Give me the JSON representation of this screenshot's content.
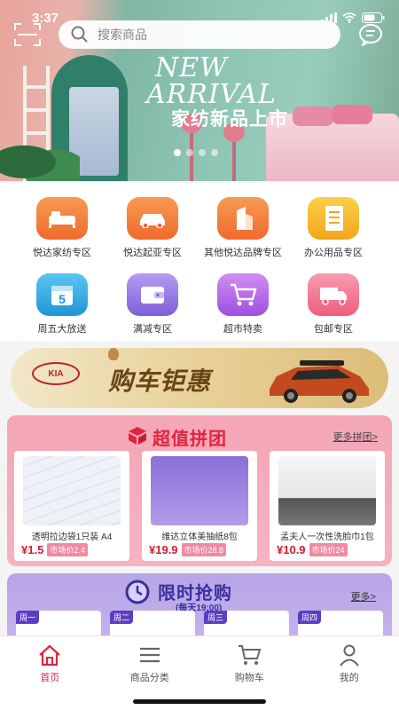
{
  "status": {
    "time": "3:37"
  },
  "search": {
    "placeholder": "搜索商品"
  },
  "banner": {
    "headline_line1": "NEW",
    "headline_line2": "ARRIVAL",
    "subtitle": "家纺新品上市",
    "active_slide": 1,
    "slide_count": 4
  },
  "categories": [
    {
      "label": "悦达家纺专区",
      "icon": "bed-icon",
      "color": "#f07a3a"
    },
    {
      "label": "悦达起亚专区",
      "icon": "car-icon",
      "color": "#f07a3a"
    },
    {
      "label": "其他悦达品牌专区",
      "icon": "building-icon",
      "color": "#f07a3a"
    },
    {
      "label": "办公用品专区",
      "icon": "notebook-icon",
      "color": "#f6b21e"
    },
    {
      "label": "周五大放送",
      "icon": "calendar-icon",
      "color": "#2aa8e8"
    },
    {
      "label": "满减专区",
      "icon": "wallet-icon",
      "color": "#8e72e0"
    },
    {
      "label": "超市特卖",
      "icon": "shopping-cart-icon",
      "color": "#a45be0"
    },
    {
      "label": "包邮专区",
      "icon": "truck-icon",
      "color": "#f06d86"
    }
  ],
  "car_promo": {
    "brand": "KIA",
    "headline": "购车钜惠"
  },
  "group_buy": {
    "title": "超值拼团",
    "more": "更多拼团>",
    "items": [
      {
        "name": "透明拉边袋1只装 A4",
        "price": "¥1.5",
        "market": "市场价2.4"
      },
      {
        "name": "维达立体美抽纸8包",
        "price": "¥19.9",
        "market": "市场价28.8"
      },
      {
        "name": "孟夫人一次性洗脸巾1包",
        "price": "¥10.9",
        "market": "市场价24"
      }
    ]
  },
  "flash_sale": {
    "title": "限时抢购",
    "subtitle": "(每天19:00)",
    "more": "更多>",
    "day_tags": [
      "周一",
      "周二",
      "周三",
      "周四"
    ]
  },
  "tabbar": [
    {
      "label": "首页",
      "icon": "home-icon",
      "active": true
    },
    {
      "label": "商品分类",
      "icon": "list-icon",
      "active": false
    },
    {
      "label": "购物车",
      "icon": "cart-icon",
      "active": false
    },
    {
      "label": "我的",
      "icon": "profile-icon",
      "active": false
    }
  ],
  "colors": {
    "accent_red": "#e0243f",
    "flash_purple": "#3a2f9e"
  }
}
